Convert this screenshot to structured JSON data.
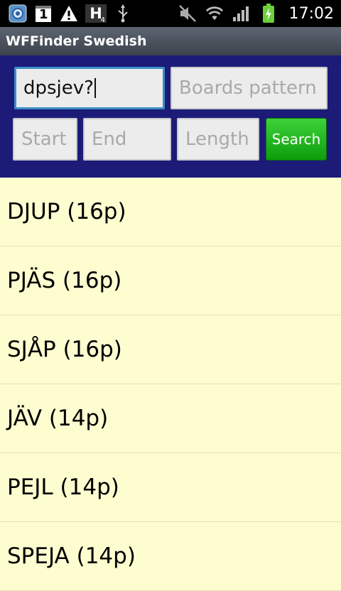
{
  "status_bar": {
    "clock": "17:02",
    "signal_label": "H",
    "signal_sub": "4",
    "notification_count": "1",
    "left_icons": [
      "app-icon",
      "calendar-icon",
      "warning-icon",
      "hspa-icon",
      "usb-icon"
    ],
    "right_icons": [
      "mute-icon",
      "wifi-icon",
      "signal-icon",
      "battery-charging-icon"
    ]
  },
  "app": {
    "title": "WFFinder Swedish"
  },
  "search": {
    "letters_value": "dpsjev?",
    "boards_placeholder": "Boards pattern",
    "start_placeholder": "Start",
    "end_placeholder": "End",
    "length_placeholder": "Length",
    "search_label": "Search"
  },
  "results": [
    {
      "text": "DJUP  (16p)"
    },
    {
      "text": "PJÄS  (16p)"
    },
    {
      "text": "SJÅP  (16p)"
    },
    {
      "text": "JÄV  (14p)"
    },
    {
      "text": "PEJL  (14p)"
    },
    {
      "text": "SPEJA  (14p)"
    }
  ],
  "colors": {
    "panel_bg": "#1c1b78",
    "list_bg": "#fdfdd0",
    "search_button": "#22b51f",
    "focus_border": "#3b8ec7"
  }
}
